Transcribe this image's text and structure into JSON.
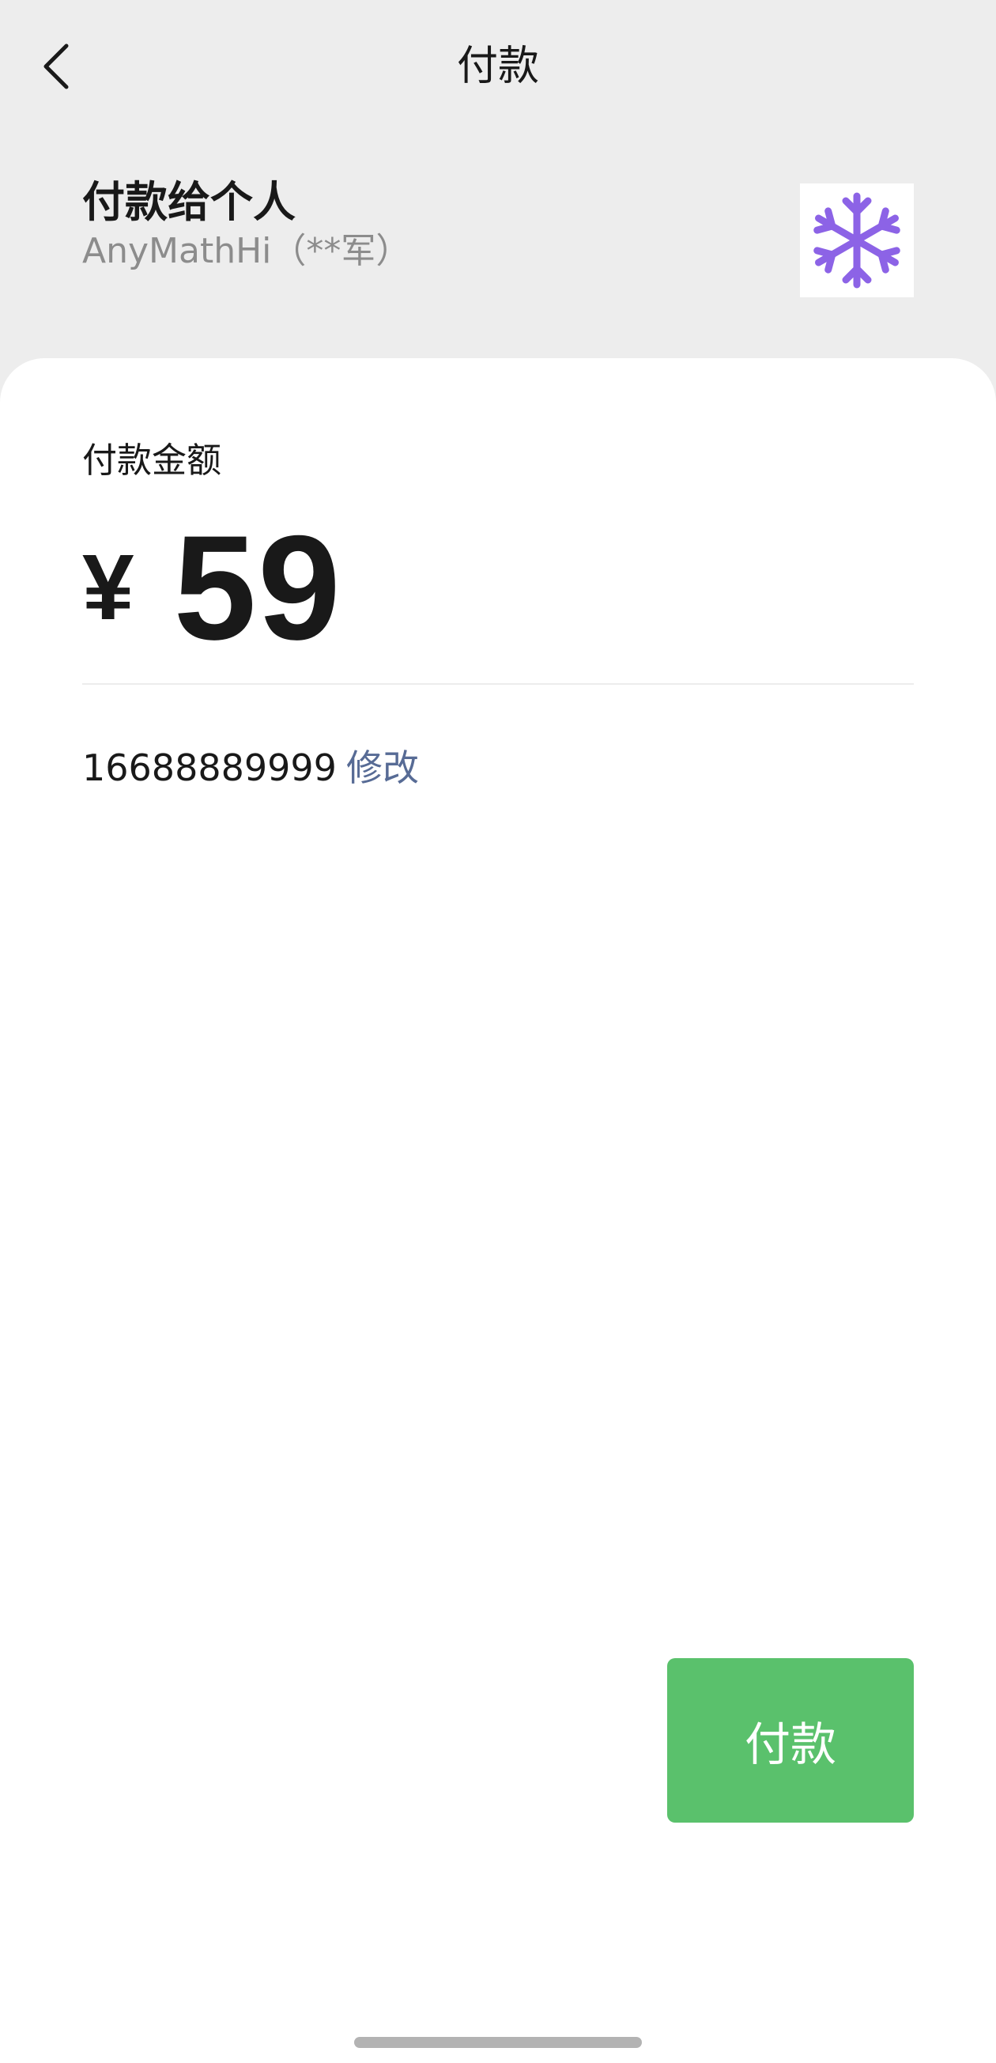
{
  "header": {
    "title": "付款",
    "back_icon": "chevron-left-icon"
  },
  "payee": {
    "title": "付款给个人",
    "name": "AnyMathHi（**军）",
    "avatar_icon": "snowflake-icon",
    "avatar_color": "#8c63e6"
  },
  "payment": {
    "amount_label": "付款金额",
    "currency_symbol": "¥",
    "amount": "59",
    "phone": "16688889999",
    "edit_label": "修改",
    "pay_button_label": "付款"
  },
  "colors": {
    "background": "#ededed",
    "card": "#ffffff",
    "link": "#576b95",
    "pay_button": "#5ac16c"
  }
}
